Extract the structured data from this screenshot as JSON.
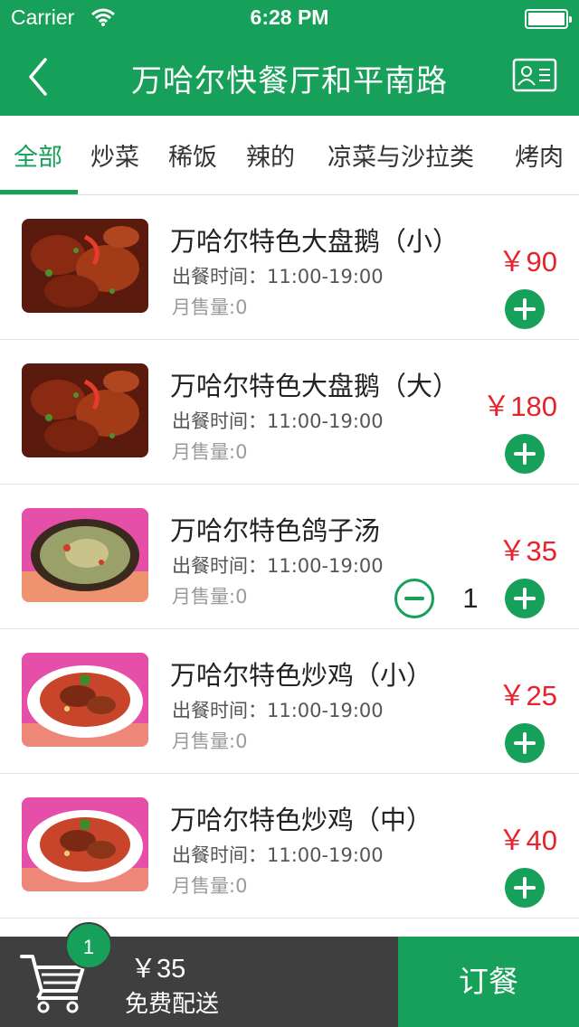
{
  "status_bar": {
    "carrier": "Carrier",
    "time": "6:28 PM"
  },
  "header": {
    "title": "万哈尔快餐厅和平南路",
    "back_icon": "chevron-left-icon",
    "card_icon": "contact-card-icon"
  },
  "tabs": [
    {
      "label": "全部",
      "active": true
    },
    {
      "label": "炒菜"
    },
    {
      "label": "稀饭"
    },
    {
      "label": "辣的"
    },
    {
      "label": "凉菜与沙拉类"
    },
    {
      "label": "烤肉"
    }
  ],
  "items": [
    {
      "name": "万哈尔特色大盘鹅（小）",
      "hours": "出餐时间：11:00-19:00",
      "sold": "月售量:0",
      "price": "￥90"
    },
    {
      "name": "万哈尔特色大盘鹅（大）",
      "hours": "出餐时间：11:00-19:00",
      "sold": "月售量:0",
      "price": "￥180"
    },
    {
      "name": "万哈尔特色鸽子汤",
      "hours": "出餐时间：11:00-19:00",
      "sold": "月售量:0",
      "price": "￥35",
      "quantity": "1"
    },
    {
      "name": "万哈尔特色炒鸡（小）",
      "hours": "出餐时间：11:00-19:00",
      "sold": "月售量:0",
      "price": "￥25"
    },
    {
      "name": "万哈尔特色炒鸡（中）",
      "hours": "出餐时间：11:00-19:00",
      "sold": "月售量:0",
      "price": "￥40"
    }
  ],
  "cart": {
    "count": "1",
    "total": "￥35",
    "delivery": "免费配送",
    "order_label": "订餐",
    "cart_icon": "shopping-cart-icon"
  },
  "colors": {
    "primary": "#17a05a",
    "price": "#e8222a",
    "cart_bg": "#3f3f3f"
  }
}
